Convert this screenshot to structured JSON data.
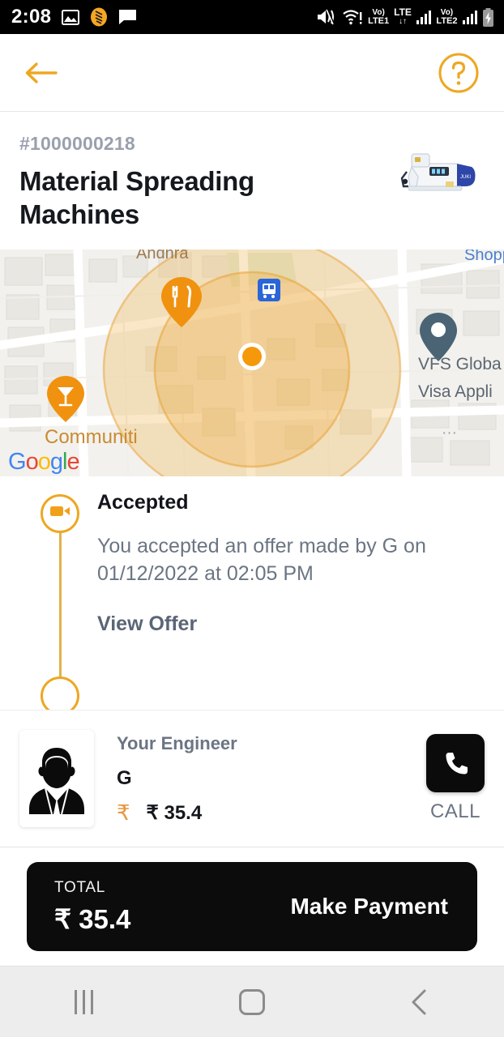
{
  "statusbar": {
    "time": "2:08",
    "left_icons": [
      "photo-icon",
      "app-badge-icon",
      "message-icon"
    ],
    "volte1_top": "Vo)",
    "volte1_bot": "LTE1",
    "lte_top": "LTE",
    "lte_bot": "↓↑",
    "volte2_top": "Vo)",
    "volte2_bot": "LTE2",
    "right_icons": [
      "mute-icon",
      "wifi-warning-icon",
      "signal-bars-icon",
      "signal-bars-icon",
      "battery-charging-icon"
    ]
  },
  "appbar": {
    "back_label": "back-arrow",
    "help_label": "help"
  },
  "order": {
    "id": "#1000000218",
    "title": "Material Spreading Machines",
    "product_image_alt": "industrial-sewing-machine"
  },
  "map": {
    "labels": {
      "vfs_line1": "VFS Globa",
      "vfs_line2": "Visa Appli",
      "shopping": "Shopp",
      "andhra": "Andhra",
      "communiti": "Communiti"
    },
    "google_watermark": [
      "G",
      "o",
      "o",
      "g",
      "l",
      "e"
    ],
    "pins": [
      "restaurant-pin",
      "bar-pin",
      "bus-stop-icon",
      "place-pin",
      "current-location-dot"
    ],
    "accent_color": "#f5a623",
    "radius_fill": "#f2bc64"
  },
  "timeline": {
    "icon": "video-camera-icon",
    "status": "Accepted",
    "description": "You accepted an offer made by G on 01/12/2022 at 02:05 PM",
    "link_label": "View Offer"
  },
  "engineer": {
    "avatar": "engineer-avatar-icon",
    "role_label": "Your Engineer",
    "name": "G",
    "rupee_icon": "₹",
    "price": "₹ 35.4",
    "call_icon": "phone-icon",
    "call_label": "CALL"
  },
  "payment": {
    "total_label": "TOTAL",
    "amount": "₹ 35.4",
    "cta_label": "Make Payment"
  },
  "navbar": {
    "recents_label": "recents",
    "home_label": "home",
    "back_label": "back"
  },
  "colors": {
    "accent": "#eda822",
    "dark": "#0c0c0c",
    "muted": "#6b7583"
  }
}
